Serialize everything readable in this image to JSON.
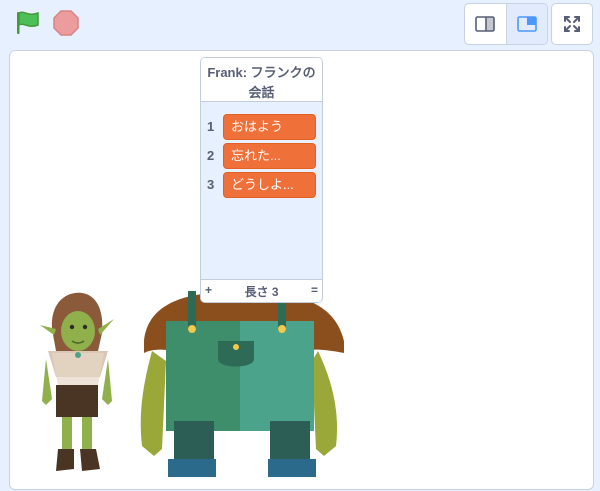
{
  "toolbar": {
    "green_flag_icon": "green-flag-icon",
    "stop_icon": "stop-icon",
    "small_stage_icon": "small-stage-icon",
    "normal_stage_icon": "normal-stage-icon",
    "fullscreen_icon": "fullscreen-icon"
  },
  "list_monitor": {
    "title": "Frank: フランクの会話",
    "items": [
      {
        "index": "1",
        "value": "おはよう"
      },
      {
        "index": "2",
        "value": "忘れた..."
      },
      {
        "index": "3",
        "value": "どうしよ..."
      }
    ],
    "add_label": "+",
    "length_label": "長さ 3",
    "resize_label": "="
  },
  "sprites": [
    "goblin",
    "troll-frank"
  ],
  "colors": {
    "background": "#e6f0ff",
    "list_item": "#f0703a",
    "green_flag": "#4cbf56",
    "stop": "#ec9c9c"
  }
}
